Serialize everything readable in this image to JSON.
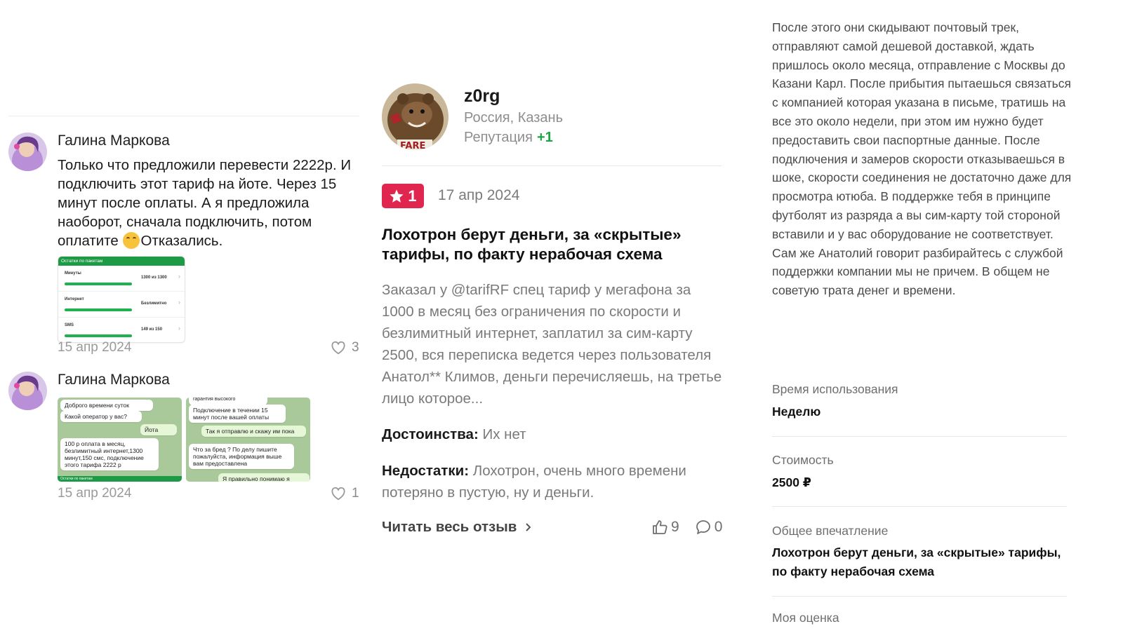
{
  "comments": [
    {
      "author": "Галина Маркова",
      "text_before_emoji": "Только что предложили перевести 2222р. И подключить этот тариф на йоте. Через 15 минут после оплаты. А я предложила наоборот, сначала подключить, потом оплатите ",
      "text_after_emoji": "Отказались.",
      "date": "15 апр 2024",
      "likes": "3",
      "attachment": {
        "header": "Остатки по пакетам",
        "rows": [
          {
            "name": "Минуты",
            "value": "1300 из 1300"
          },
          {
            "name": "Интернет",
            "value": "Безлимитно"
          },
          {
            "name": "SMS",
            "value": "149 из 150"
          }
        ]
      }
    },
    {
      "author": "Галина Маркова",
      "date": "15 апр 2024",
      "likes": "1",
      "chat1": {
        "m1": "Доброго времени суток",
        "m2": "Какой оператор у вас?",
        "m3": "Йота",
        "m4": "100 р оплата в месяц, безлимитный интернет,1300 минут,150 смс, подключение этого тарифа 2222 р",
        "strip": "Остатки по пакетам"
      },
      "chat2": {
        "m0": "гарантия высокого",
        "m1": "Подключение в течении 15 минут после вашей оплаты",
        "m2": "Так я отправлю и скажу им пока",
        "m3": "Что за бред ? По делу пишите пожалуйста, информация выше вам предоставлена",
        "m4": "Я правильно понимаю я"
      }
    }
  ],
  "review": {
    "username": "z0rg",
    "location": "Россия, Казань",
    "reputation_label": "Репутация",
    "reputation_value": "+1",
    "rating": "1",
    "date": "17 апр 2024",
    "title": "Лохотрон берут деньги, за «скрытые» тарифы, по факту нерабочая схема",
    "body": "Заказал у @tarifRF спец тариф у мегафона за 1000 в месяц без ограничения по скорости и безлимитный интернет, заплатил за сим-карту 2500, вся переписка ведется через пользователя Анатол** Климов, деньги перечисляешь, на третье лицо которое...",
    "pros_label": "Достоинства:",
    "pros": "Их нет",
    "cons_label": "Недостатки:",
    "cons": "Лохотрон, очень много времени потеряно в пустую, ну и деньги.",
    "read_more": "Читать весь отзыв",
    "likes": "9",
    "comments": "0"
  },
  "full_review": {
    "text": "После этого они скидывают почтовый трек, отправляют самой дешевой доставкой, ждать пришлось около месяца, отправление с Москвы до Казани Карл. После прибытия пытаешься связаться с компанией которая указана в письме, тратишь на все это около недели, при этом им нужно будет предоставить свои паспортные данные. После подключения и замеров скорости отказываешься в шоке, скорости соединения не достаточно даже для просмотра ютюба. В поддержке тебя в принципе футболят из разряда а вы сим-карту той стороной вставили и у вас оборудование не соответствует. Сам же Анатолий говорит разбирайтесь с службой поддержки компании мы не причем. В общем не советую трата денег и времени.",
    "usage_label": "Время использования",
    "usage_value": "Неделю",
    "cost_label": "Стоимость",
    "cost_value": "2500 ₽",
    "impression_label": "Общее впечатление",
    "impression_value": "Лохотрон берут деньги, за «скрытые» тарифы, по факту нерабочая схема",
    "rating_label": "Моя оценка"
  },
  "colors": {
    "badge": "#e0254f",
    "positive": "#1ea34a",
    "muted": "#7a7a7a"
  }
}
